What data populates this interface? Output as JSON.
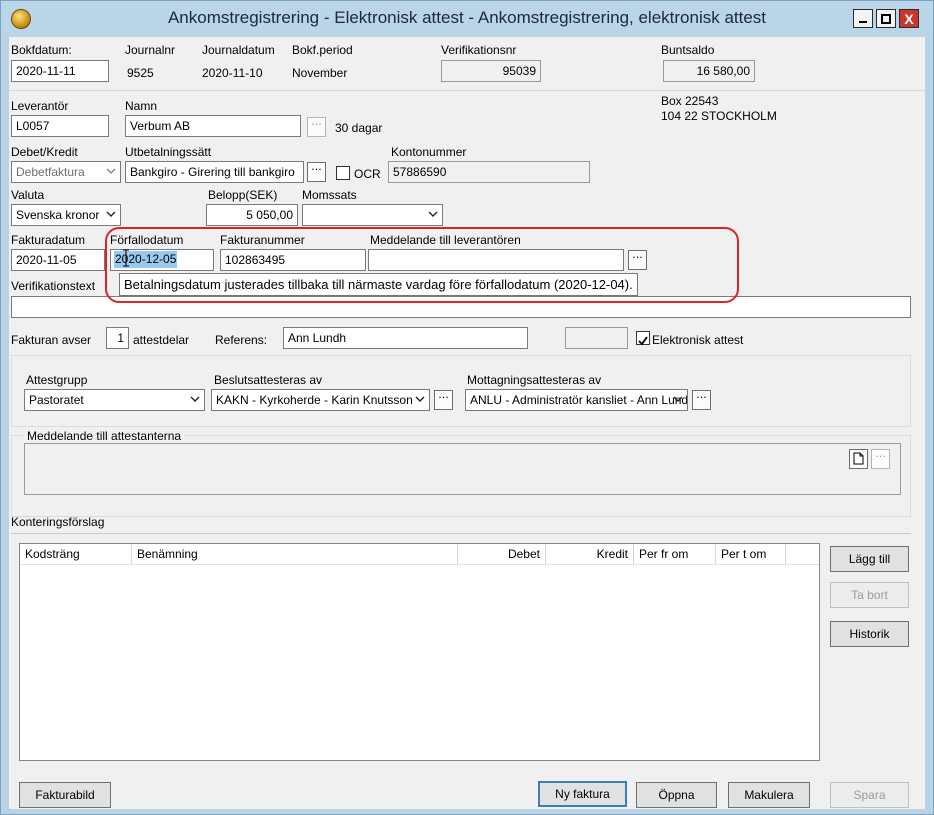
{
  "window": {
    "title": "Ankomstregistrering - Elektronisk attest - Ankomstregistrering, elektronisk attest",
    "min_glyph": "▁",
    "max_glyph": "□",
    "close_glyph": "X"
  },
  "header": {
    "bokfdatum_label": "Bokfdatum:",
    "bokfdatum_value": "2020-11-11",
    "journalnr_label": "Journalnr",
    "journalnr_value": "9525",
    "journaldatum_label": "Journaldatum",
    "journaldatum_value": "2020-11-10",
    "bokfperiod_label": "Bokf.period",
    "bokfperiod_value": "November",
    "verifikationsnr_label": "Verifikationsnr",
    "verifikationsnr_value": "95039",
    "buntsaldo_label": "Buntsaldo",
    "buntsaldo_value": "16 580,00"
  },
  "supplier": {
    "leverantor_label": "Leverantör",
    "leverantor_value": "L0057",
    "namn_label": "Namn",
    "namn_value": "Verbum AB",
    "terms": "30 dagar",
    "address_line1": "Box 22543",
    "address_line2": "104 22  STOCKHOLM",
    "debet_kredit_label": "Debet/Kredit",
    "debet_kredit_value": "Debetfaktura",
    "utbetalningssatt_label": "Utbetalningssätt",
    "utbetalningssatt_value": "Bankgiro - Girering till bankgiro",
    "ocr_label": "OCR",
    "kontonummer_label": "Kontonummer",
    "kontonummer_value": "57886590"
  },
  "amounts": {
    "valuta_label": "Valuta",
    "valuta_value": "Svenska kronor",
    "belopp_label": "Belopp(SEK)",
    "belopp_value": "5 050,00",
    "momssats_label": "Momssats",
    "momssats_value": ""
  },
  "invoice": {
    "fakturadatum_label": "Fakturadatum",
    "fakturadatum_value": "2020-11-05",
    "forfallodatum_label": "Förfallodatum",
    "forfallodatum_value": "2020-12-05",
    "fakturanummer_label": "Fakturanummer",
    "fakturanummer_value": "102863495",
    "meddelande_label": "Meddelande till leverantören",
    "meddelande_value": "",
    "tooltip": "Betalningsdatum justerades tillbaka till närmaste vardag före förfallodatum (2020-12-04).",
    "verifikationstext_label": "Verifikationstext",
    "verifikationstext_value": ""
  },
  "attest": {
    "fakturan_avser_label": "Fakturan avser",
    "attestdelar_value": "1",
    "attestdelar_label": "attestdelar",
    "referens_label": "Referens:",
    "referens_value": "Ann Lundh",
    "elektronisk_attest_label": "Elektronisk attest",
    "elektronisk_attest_checked": true,
    "attestgrupp_label": "Attestgrupp",
    "attestgrupp_value": "Pastoratet",
    "beslut_label": "Beslutsattesteras av",
    "beslut_value": "KAKN - Kyrkoherde - Karin Knutsson",
    "mottag_label": "Mottagningsattesteras av",
    "mottag_value": "ANLU - Administratör kansliet - Ann Lundh",
    "meddelande_attest_label": "Meddelande till attestanterna"
  },
  "kontering": {
    "label": "Konteringsförslag",
    "columns": [
      "Kodsträng",
      "Benämning",
      "Debet",
      "Kredit",
      "Per fr om",
      "Per t om"
    ],
    "rows": [],
    "lagg_till": "Lägg till",
    "ta_bort": "Ta bort",
    "historik": "Historik"
  },
  "footer": {
    "fakturabild": "Fakturabild",
    "ny_faktura": "Ny faktura",
    "oppna": "Öppna",
    "makulera": "Makulera",
    "spara": "Spara"
  },
  "colors": {
    "title_bar": "#bad4e8",
    "selection": "#99c9ef",
    "annotation": "#d9252a",
    "close_button": "#c9372c"
  }
}
